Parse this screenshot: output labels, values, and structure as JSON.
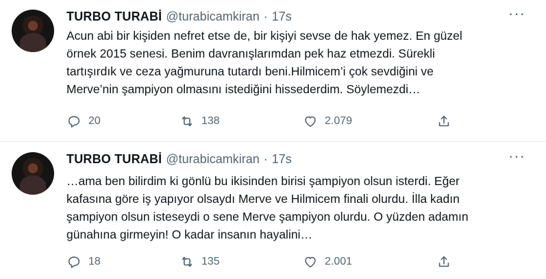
{
  "tweets": [
    {
      "name": "TURBO TURABİ",
      "handle": "@turabicamkiran",
      "separator": "·",
      "time": "17s",
      "more_icon": "more-horizontal-icon",
      "lines": [
        "Acun abi bir kişiden nefret etse de, bir kişiyi sevse de hak yemez. En güzel",
        "örnek 2015 senesi. Benim davranışlarımdan pek haz etmezdi. Sürekli",
        "tartışırdık ve ceza yağmuruna tutardı beni.Hilmicem’i çok sevdiğini ve",
        "Merve’nin şampiyon olmasını istediğini hissederdim. Söylemezdi…"
      ],
      "replies": "20",
      "retweets": "138",
      "likes": "2.079"
    },
    {
      "name": "TURBO TURABİ",
      "handle": "@turabicamkiran",
      "separator": "·",
      "time": "17s",
      "more_icon": "more-horizontal-icon",
      "lines": [
        "…ama ben bilirdim ki gönlü bu ikisinden birisi şampiyon olsun isterdi. Eğer",
        "kafasına göre iş yapıyor olsaydı Merve ve Hilmicem finali olurdu. İlla kadın",
        "şampiyon olsun isteseydi o sene Merve şampiyon olurdu. O yüzden adamın",
        "günahına girmeyin! O kadar insanın hayalini…"
      ],
      "replies": "18",
      "retweets": "135",
      "likes": "2.001"
    }
  ],
  "icons": {
    "reply": "reply-icon",
    "retweet": "retweet-icon",
    "like": "like-icon",
    "share": "share-icon"
  },
  "colors": {
    "text": "#0f1419",
    "secondary": "#536471",
    "divider": "#e6ecf0"
  }
}
